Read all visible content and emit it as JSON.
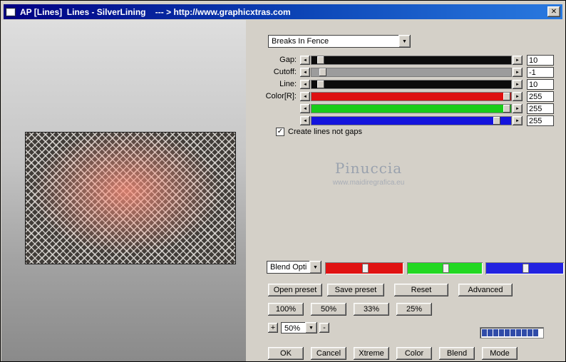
{
  "icons": {
    "left_arrow": "◄",
    "right_arrow": "►",
    "down_arrow": "▼",
    "check": "✓",
    "close": "✕",
    "plus": "+",
    "minus": "-"
  },
  "window": {
    "title": "AP [Lines]  Lines - SilverLining    --- > http://www.graphicxtras.com"
  },
  "panel": {
    "preset_combo": {
      "value": "Breaks In Fence"
    },
    "sliders": [
      {
        "label": "Gap:",
        "value": "10",
        "track_color": "#0c0c0c",
        "thumb_left": "3%"
      },
      {
        "label": "Cutoff:",
        "value": "-1",
        "track_color": "#9c9c9c",
        "thumb_left": "4%"
      },
      {
        "label": "Line:",
        "value": "10",
        "track_color": "#0c0c0c",
        "thumb_left": "3%"
      },
      {
        "label": "Color[R]:",
        "value": "255",
        "track_color": "#dd1111",
        "thumb_left": "96%"
      },
      {
        "label": "",
        "value": "255",
        "track_color": "#19cc19",
        "thumb_left": "96%"
      },
      {
        "label": "",
        "value": "255",
        "track_color": "#1414dd",
        "thumb_left": "91%"
      }
    ],
    "checkbox": {
      "label": "Create lines not gaps",
      "checked": true
    },
    "watermark": {
      "name": "Pinuccia",
      "url": "www.maidiregrafica.eu"
    },
    "blend_combo": {
      "value": "Blend Opti"
    },
    "rgb_sliders": [
      {
        "name": "red",
        "color": "#e01212",
        "thumb_left": "47%"
      },
      {
        "name": "green",
        "color": "#22d822",
        "thumb_left": "47%"
      },
      {
        "name": "blue",
        "color": "#2222e0",
        "thumb_left": "47%"
      }
    ],
    "preset_buttons": [
      {
        "label": "Open preset"
      },
      {
        "label": "Save preset"
      },
      {
        "label": "Reset"
      },
      {
        "label": "Advanced"
      }
    ],
    "zoom_presets": [
      {
        "label": "100%"
      },
      {
        "label": "50%"
      },
      {
        "label": "33%"
      },
      {
        "label": "25%"
      }
    ],
    "zoom": {
      "value": "50%"
    },
    "progress": {
      "segments": 10,
      "filled": 10,
      "color": "#2f4ba8"
    },
    "action_buttons": [
      {
        "label": "OK"
      },
      {
        "label": "Cancel"
      },
      {
        "label": "Xtreme"
      },
      {
        "label": "Color"
      },
      {
        "label": "Blend"
      },
      {
        "label": "Mode"
      }
    ]
  }
}
